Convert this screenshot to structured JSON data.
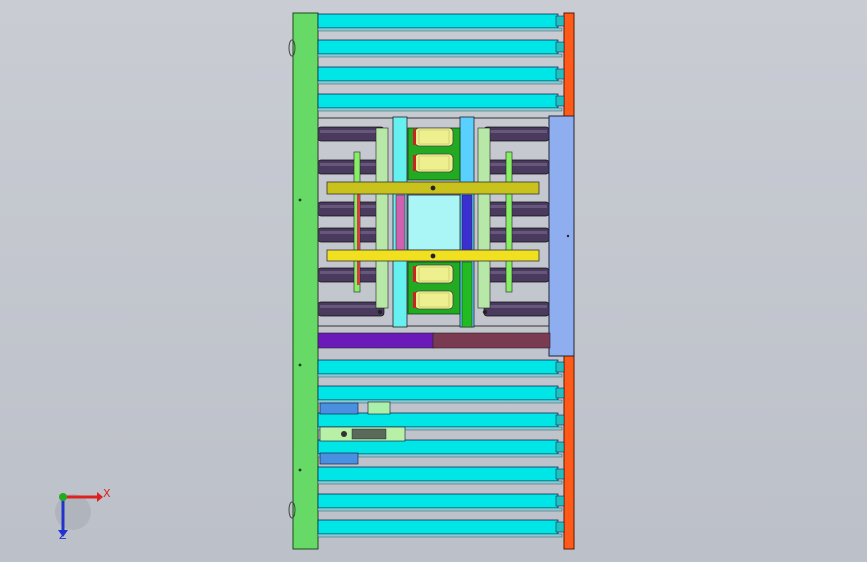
{
  "viewport": {
    "background_color": "#c5c8cf"
  },
  "model": {
    "colors": {
      "roller_cyan": "#00e5e5",
      "roller_dark": "#4a3a5e",
      "frame_left": "#66d966",
      "frame_right": "#ff5a1a",
      "guard_plate": "#8faef0",
      "beam_olive": "#c9c21c",
      "beam_yellow": "#f0e020",
      "rail_green": "#22bb22",
      "rail_blue": "#3a2fd0",
      "rail_pink": "#d060b0",
      "bar_purple": "#6a1ab8",
      "bar_maroon": "#7a3a52",
      "motor_yellow": "#eef090"
    }
  },
  "triad": {
    "x_label": "X",
    "z_label": "Z",
    "x_color": "#dd2222",
    "y_color": "#22aa22",
    "z_color": "#2233cc"
  }
}
